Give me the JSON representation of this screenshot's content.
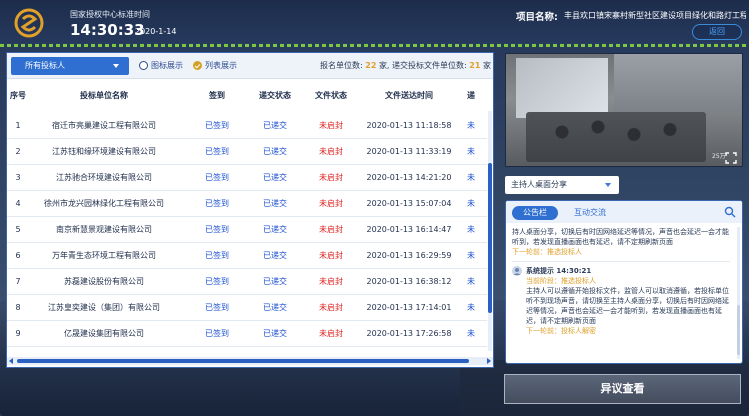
{
  "header": {
    "center_label": "国家授权中心标准时间",
    "time": "14:30:33",
    "date": "2020-1-14",
    "project_label": "项目名称:",
    "project_name": "丰县欢口镇宋寨村新型社区建设项目绿化和路灯工程",
    "back_label": "返回"
  },
  "toolbar": {
    "bidder_select": "所有投标人",
    "radio_chart": "图标展示",
    "radio_list": "列表展示",
    "stats_prefix": "报名单位数:",
    "stats_count": "22",
    "stats_mid": "家, 递交投标文件单位数:",
    "stats_submitted": "21",
    "stats_suffix": "家"
  },
  "table": {
    "headers": [
      "序号",
      "投标单位名称",
      "签到",
      "递交状态",
      "文件状态",
      "文件送达时间",
      "递"
    ],
    "rows": [
      {
        "no": "1",
        "name": "宿迁市亮巢建设工程有限公司",
        "signin": "已签到",
        "submit": "已递交",
        "file": "未启封",
        "time": "2020-01-13 11:18:58",
        "more": "未"
      },
      {
        "no": "2",
        "name": "江苏钰和缘环境建设有限公司",
        "signin": "已签到",
        "submit": "已递交",
        "file": "未启封",
        "time": "2020-01-13 11:33:19",
        "more": "未"
      },
      {
        "no": "3",
        "name": "江苏驰合环境建设有限公司",
        "signin": "已签到",
        "submit": "已递交",
        "file": "未启封",
        "time": "2020-01-13 14:21:20",
        "more": "未"
      },
      {
        "no": "4",
        "name": "徐州市龙兴园林绿化工程有限公司",
        "signin": "已签到",
        "submit": "已递交",
        "file": "未启封",
        "time": "2020-01-13 15:07:04",
        "more": "未"
      },
      {
        "no": "5",
        "name": "南京新慧景观建设有限公司",
        "signin": "已签到",
        "submit": "已递交",
        "file": "未启封",
        "time": "2020-01-13 16:14:47",
        "more": "未"
      },
      {
        "no": "6",
        "name": "万年青生态环境工程有限公司",
        "signin": "已签到",
        "submit": "已递交",
        "file": "未启封",
        "time": "2020-01-13 16:29:59",
        "more": "未"
      },
      {
        "no": "7",
        "name": "苏磊建设股份有限公司",
        "signin": "已签到",
        "submit": "已递交",
        "file": "未启封",
        "time": "2020-01-13 16:38:12",
        "more": "未"
      },
      {
        "no": "8",
        "name": "江苏皇奕建设（集团）有限公司",
        "signin": "已签到",
        "submit": "已递交",
        "file": "未启封",
        "time": "2020-01-13 17:14:01",
        "more": "未"
      },
      {
        "no": "9",
        "name": "亿晟建设集团有限公司",
        "signin": "已签到",
        "submit": "已递交",
        "file": "未启封",
        "time": "2020-01-13 17:26:58",
        "more": "未"
      }
    ]
  },
  "video": {
    "watermark": "25万"
  },
  "share": {
    "select_label": "主持人桌面分享"
  },
  "notice": {
    "tab_active": "公告栏",
    "tab_inactive": "互动交流",
    "msg1_text": "持人桌面分享，切换后有时因网络延迟等情况，声音也会延迟一会才能听到，若发现直播画面也有延迟，请不定期刷新页面",
    "msg1_link": "下一轮前：推选投标人",
    "msg2_head": "系统提示 14:30:21",
    "msg2_sender": "当前阶段：推选投标人",
    "msg2_text": "主持人可以遵循开始投标文件，监管人可以取消遵循，若投标单位听不到现场声音，请切换至主持人桌面分享，切换后有时因网络延迟等情况，声音也会延迟一会才能听到，若发现直播画面也有延迟，请不定期刷新页面",
    "msg2_link": "下一轮前：投标人解密"
  },
  "objection": {
    "label": "异议查看"
  },
  "colors": {
    "accent_blue": "#2f6fd1",
    "warning_orange": "#e0a02a",
    "error_red": "#e02020",
    "header_bg": "#1d2c4b",
    "header_line": "#7bc943"
  }
}
